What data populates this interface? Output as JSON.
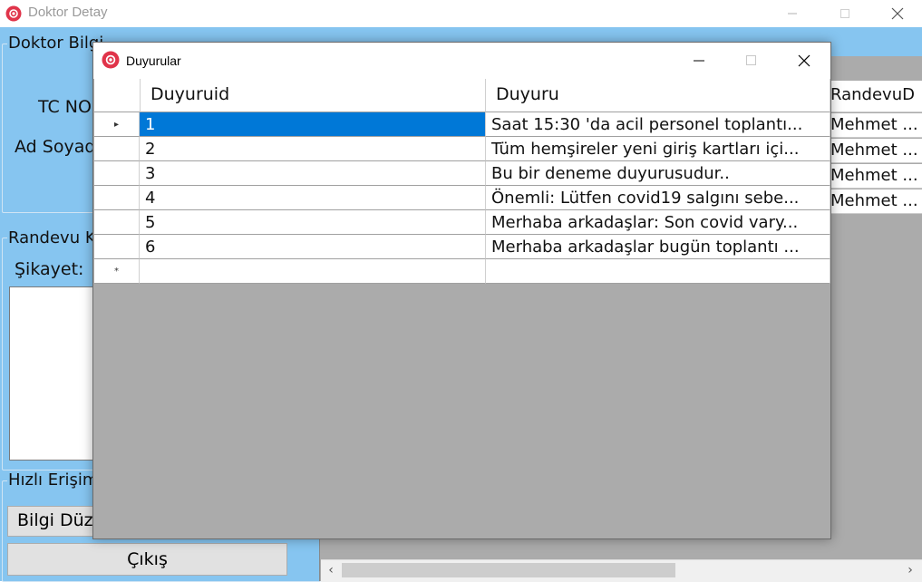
{
  "background_window": {
    "title": "Doktor Detay",
    "groups": {
      "doktor_label": "Doktor Bilgi",
      "tc_label": "TC NO",
      "ad_label": "Ad Soyad",
      "randevu_label": "Randevu K",
      "sikayet_label": "Şikayet:",
      "hizli_label": "Hızlı Erişim",
      "bilgi_button": "Bilgi Düzen",
      "cikis_button": "Çıkış"
    },
    "grid": {
      "header": "RandevuD",
      "rows": [
        "Mehmet ...",
        "Mehmet ...",
        "Mehmet ...",
        "Mehmet ..."
      ]
    }
  },
  "modal": {
    "title": "Duyurular",
    "columns": [
      "Duyuruid",
      "Duyuru"
    ],
    "rows": [
      {
        "id": "1",
        "text": "Saat 15:30 'da acil personel toplantı..."
      },
      {
        "id": "2",
        "text": "Tüm hemşireler yeni giriş kartları içi..."
      },
      {
        "id": "3",
        "text": "Bu bir deneme duyurusudur.."
      },
      {
        "id": "4",
        "text": "Önemli: Lütfen covid19 salgını sebe..."
      },
      {
        "id": "5",
        "text": "Merhaba arkadaşlar: Son covid vary..."
      },
      {
        "id": "6",
        "text": "Merhaba arkadaşlar bugün toplantı ..."
      }
    ],
    "new_row_marker": "*",
    "current_row_marker": "▸",
    "selected_row": 0
  },
  "colors": {
    "client_bg": "#86c5f0",
    "selection": "#0078d7",
    "grid_empty": "#ababab",
    "app_icon": "#e0344a"
  },
  "icons": {
    "app": "record-icon",
    "minimize": "minimize-icon",
    "maximize": "maximize-icon",
    "close": "close-icon"
  }
}
